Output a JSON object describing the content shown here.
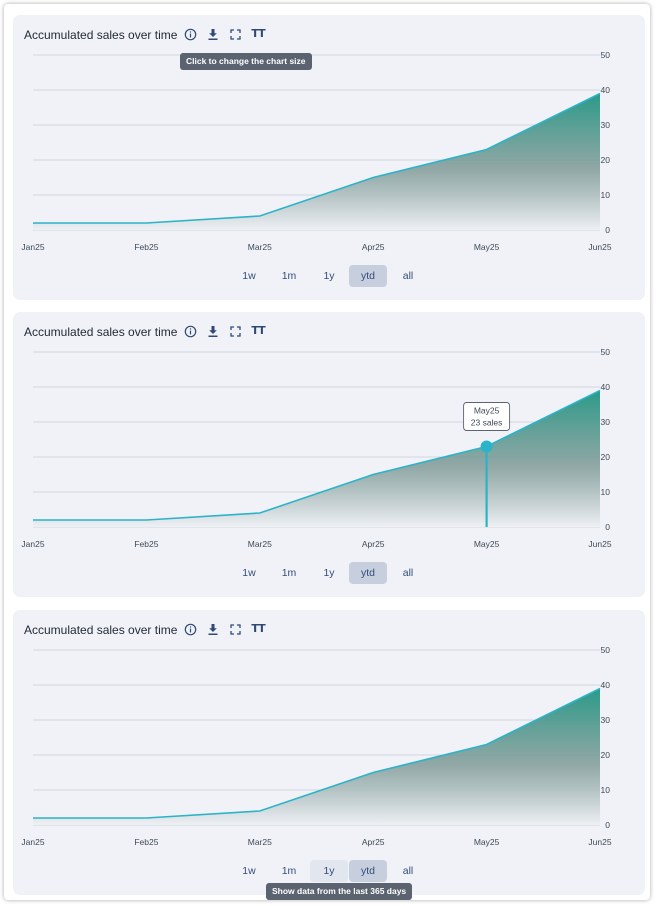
{
  "panels": [
    {
      "title": "Accumulated sales over time",
      "tooltip": "Click to change the chart size",
      "hover_range": null,
      "point_label": null
    },
    {
      "title": "Accumulated sales over time",
      "tooltip": null,
      "hover_range": null,
      "point_label": {
        "x": "May25",
        "text": "23 sales"
      }
    },
    {
      "title": "Accumulated sales over time",
      "tooltip": "Show data from the last 365 days",
      "hover_range": "1y",
      "point_label": null
    }
  ],
  "range_buttons": [
    "1w",
    "1m",
    "1y",
    "ytd",
    "all"
  ],
  "selected_range": "ytd",
  "toolbar_icons": [
    "info-icon",
    "download-icon",
    "expand-icon",
    "font-size-icon"
  ],
  "font_size_glyph": "TT",
  "colors": {
    "line": "#2bb3c9",
    "area_top": "#2a9a88",
    "area_bottom": "#eef0f4",
    "grid": "#c9ccd3",
    "selected_button": "#c7cfdf"
  },
  "chart_data": {
    "type": "area",
    "title": "Accumulated sales over time",
    "x": [
      "Jan25",
      "Feb25",
      "Mar25",
      "Apr25",
      "May25",
      "Jun25"
    ],
    "series": [
      {
        "values": [
          2,
          2,
          4,
          15,
          23,
          39
        ]
      }
    ],
    "yticks": [
      0,
      10,
      20,
      30,
      40,
      50
    ],
    "ylim": [
      0,
      50
    ],
    "y_axis_side": "right",
    "grid": true,
    "legend": false
  }
}
